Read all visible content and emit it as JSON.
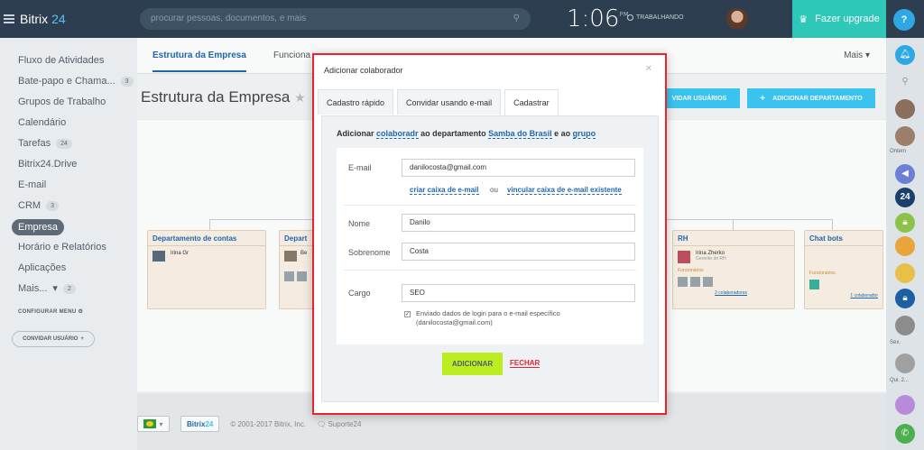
{
  "topbar": {
    "logo_name": "Bitrix",
    "logo_num": "24",
    "search_placeholder": "procurar pessoas, documentos, e mais",
    "time": "1:06",
    "ampm": "PM",
    "work_status": "TRABALHANDO",
    "upgrade_label": "Fazer upgrade"
  },
  "leftnav": {
    "items": [
      {
        "label": "Fluxo de Atividades",
        "count": ""
      },
      {
        "label": "Bate-papo e Chama...",
        "count": "3"
      },
      {
        "label": "Grupos de Trabalho",
        "count": ""
      },
      {
        "label": "Calendário",
        "count": ""
      },
      {
        "label": "Tarefas",
        "count": "24"
      },
      {
        "label": "Bitrix24.Drive",
        "count": ""
      },
      {
        "label": "E-mail",
        "count": ""
      },
      {
        "label": "CRM",
        "count": "3"
      },
      {
        "label": "Empresa",
        "count": ""
      },
      {
        "label": "Horário e Relatórios",
        "count": ""
      },
      {
        "label": "Aplicações",
        "count": ""
      },
      {
        "label": "Mais...",
        "count": "2"
      }
    ],
    "config_menu": "CONFIGURAR MENU",
    "invite_user": "CONVIDAR USUÁRIO"
  },
  "main": {
    "tabs": [
      "Estrutura da Empresa",
      "Funciona"
    ],
    "more": "Mais",
    "page_title": "Estrutura da Empresa",
    "btn_invite_users": "VIDAR USUÁRIOS",
    "btn_add_dept": "ADICIONAR DEPARTAMENTO",
    "depts": [
      {
        "name": "Departamento de contas",
        "person": "Irina Gr"
      },
      {
        "name": "Depart",
        "person": "Be"
      },
      {
        "name": "RH",
        "person": "Irina Zherko",
        "role": "Gerente de RH",
        "tag": "Funcionários",
        "link": "2 colaboradores"
      },
      {
        "name": "Chat bots",
        "tag": "Funcionários",
        "link": "1 colaborador"
      }
    ]
  },
  "footer": {
    "brand_name": "Bitrix",
    "brand_num": "24",
    "copyright": "© 2001-2017 Bitrix, Inc.",
    "support": "Suporte24"
  },
  "rightbar": {
    "labels": [
      "Ontem",
      "Sex.",
      "Qui. 2..."
    ]
  },
  "modal": {
    "title": "Adicionar colaborador",
    "tabs": [
      "Cadastro rápido",
      "Convidar usando e-mail",
      "Cadastrar"
    ],
    "heading_pre": "Adicionar",
    "heading_link1": "colaboradr",
    "heading_mid": "ao departamento",
    "heading_link2": "Samba do Brasil",
    "heading_and": "e ao",
    "heading_link3": "grupo",
    "email_label": "E-mail",
    "email_value": "danilocosta@gmail.com",
    "create_mailbox": "criar caixa de e-mail",
    "or": "ou",
    "link_mailbox": "vincular caixa de e-mail existente",
    "name_label": "Nome",
    "name_value": "Danilo",
    "surname_label": "Sobrenome",
    "surname_value": "Costa",
    "position_label": "Cargo",
    "position_value": "SEO",
    "checkbox_text_1": "Enviado dados de login para o e-mail específico",
    "checkbox_text_2": "(danilocosta@gmail.com)",
    "btn_add": "ADICIONAR",
    "btn_close": "FECHAR"
  }
}
